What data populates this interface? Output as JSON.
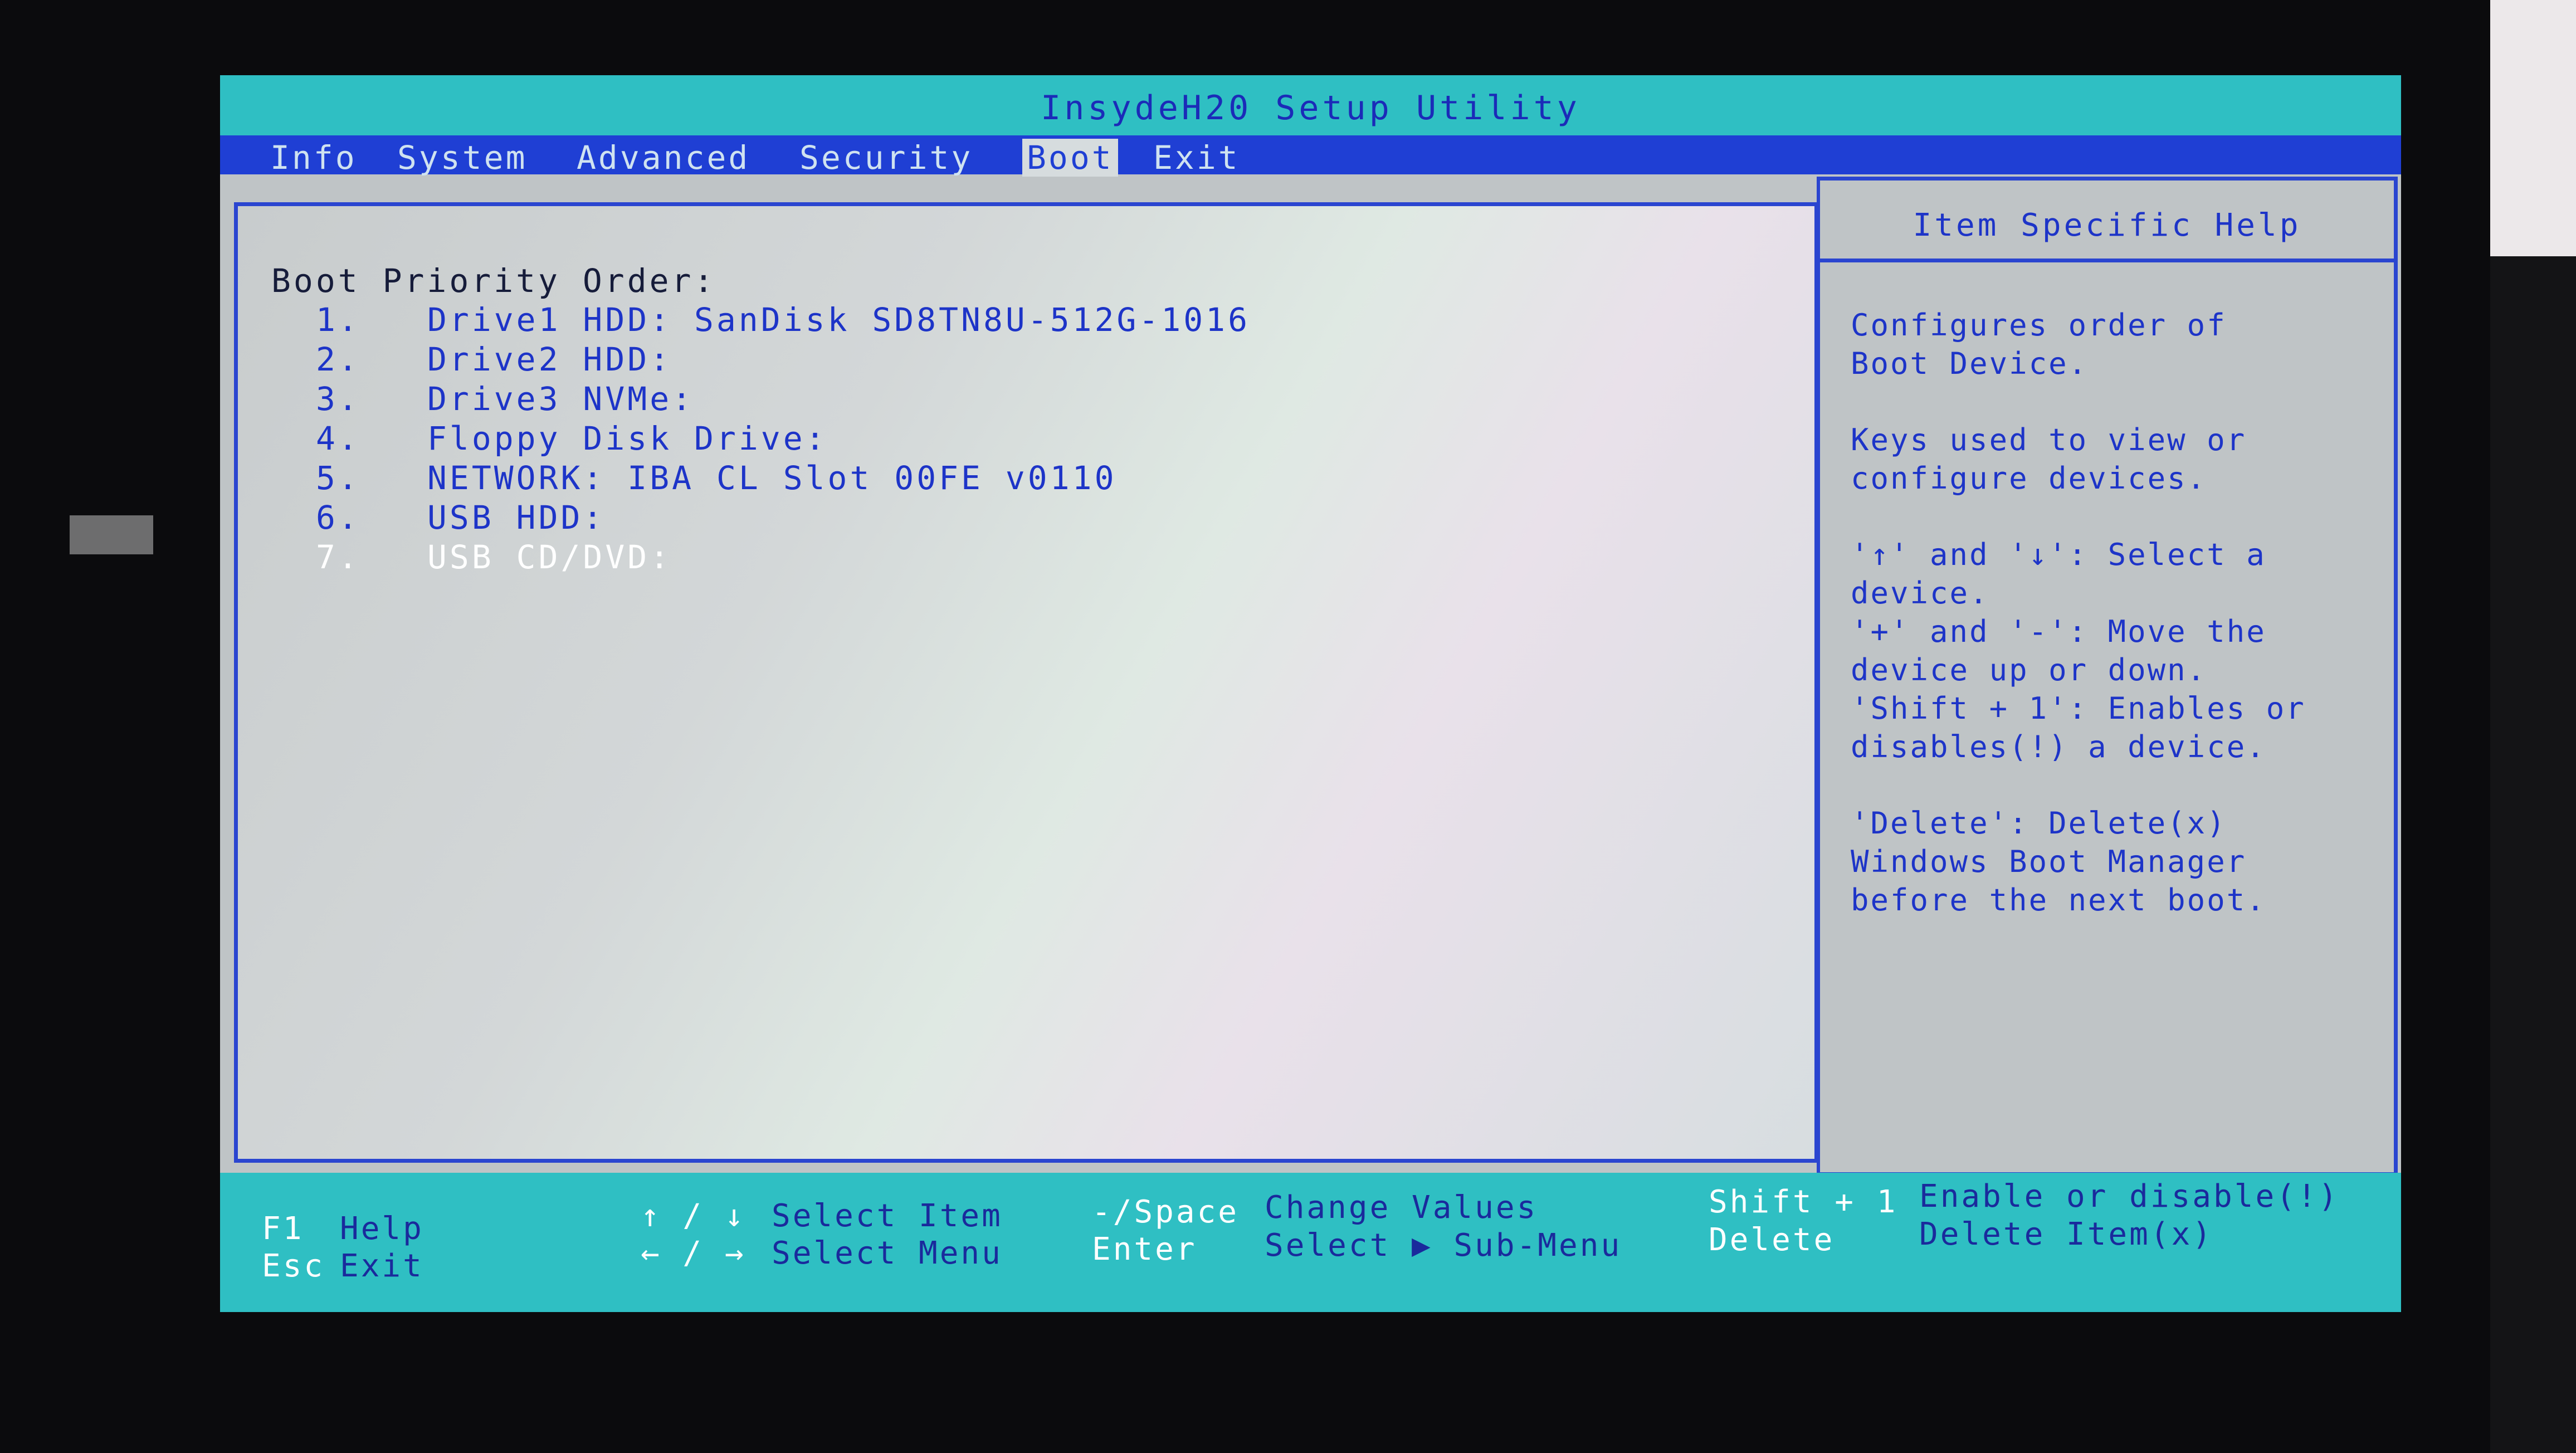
{
  "title": "InsydeH20 Setup Utility",
  "menu": {
    "items": [
      {
        "label": "Info"
      },
      {
        "label": "System"
      },
      {
        "label": "Advanced"
      },
      {
        "label": "Security"
      },
      {
        "label": "Boot"
      },
      {
        "label": "Exit"
      }
    ],
    "active": "Boot"
  },
  "boot": {
    "heading": "Boot Priority Order:",
    "items": [
      {
        "num": "1.",
        "label": "Drive1 HDD: SanDisk SD8TN8U-512G-1016"
      },
      {
        "num": "2.",
        "label": "Drive2 HDD:"
      },
      {
        "num": "3.",
        "label": "Drive3 NVMe:"
      },
      {
        "num": "4.",
        "label": "Floppy Disk Drive:"
      },
      {
        "num": "5.",
        "label": "NETWORK: IBA CL Slot 00FE v0110"
      },
      {
        "num": "6.",
        "label": "USB HDD:"
      },
      {
        "num": "7.",
        "label": "USB CD/DVD:"
      }
    ],
    "selected_index": 7
  },
  "help": {
    "title": "Item Specific Help",
    "paragraphs": [
      "Configures order of\nBoot Device.",
      "Keys used to view or\nconfigure devices.",
      "'↑' and '↓': Select a\ndevice.\n'+' and '-': Move the\ndevice up or down.\n'Shift + 1': Enables or\ndisables(!) a device.",
      "'Delete': Delete(x)\nWindows Boot Manager\nbefore the next boot."
    ]
  },
  "footer": {
    "f1_key": "F1",
    "f1_desc": "Help",
    "esc_key": "Esc",
    "esc_desc": "Exit",
    "updown_key": "↑ / ↓",
    "updown_desc": "Select Item",
    "leftright_key": "← / →",
    "leftright_desc": "Select Menu",
    "space_key": "-/Space",
    "space_desc": "Change Values",
    "enter_key": "Enter",
    "enter_desc": "Select ▶ Sub-Menu",
    "shift_key": "Shift + 1",
    "shift_desc": "Enable or disable(!)",
    "delete_key": "Delete",
    "delete_desc": "Delete Item(x)"
  }
}
